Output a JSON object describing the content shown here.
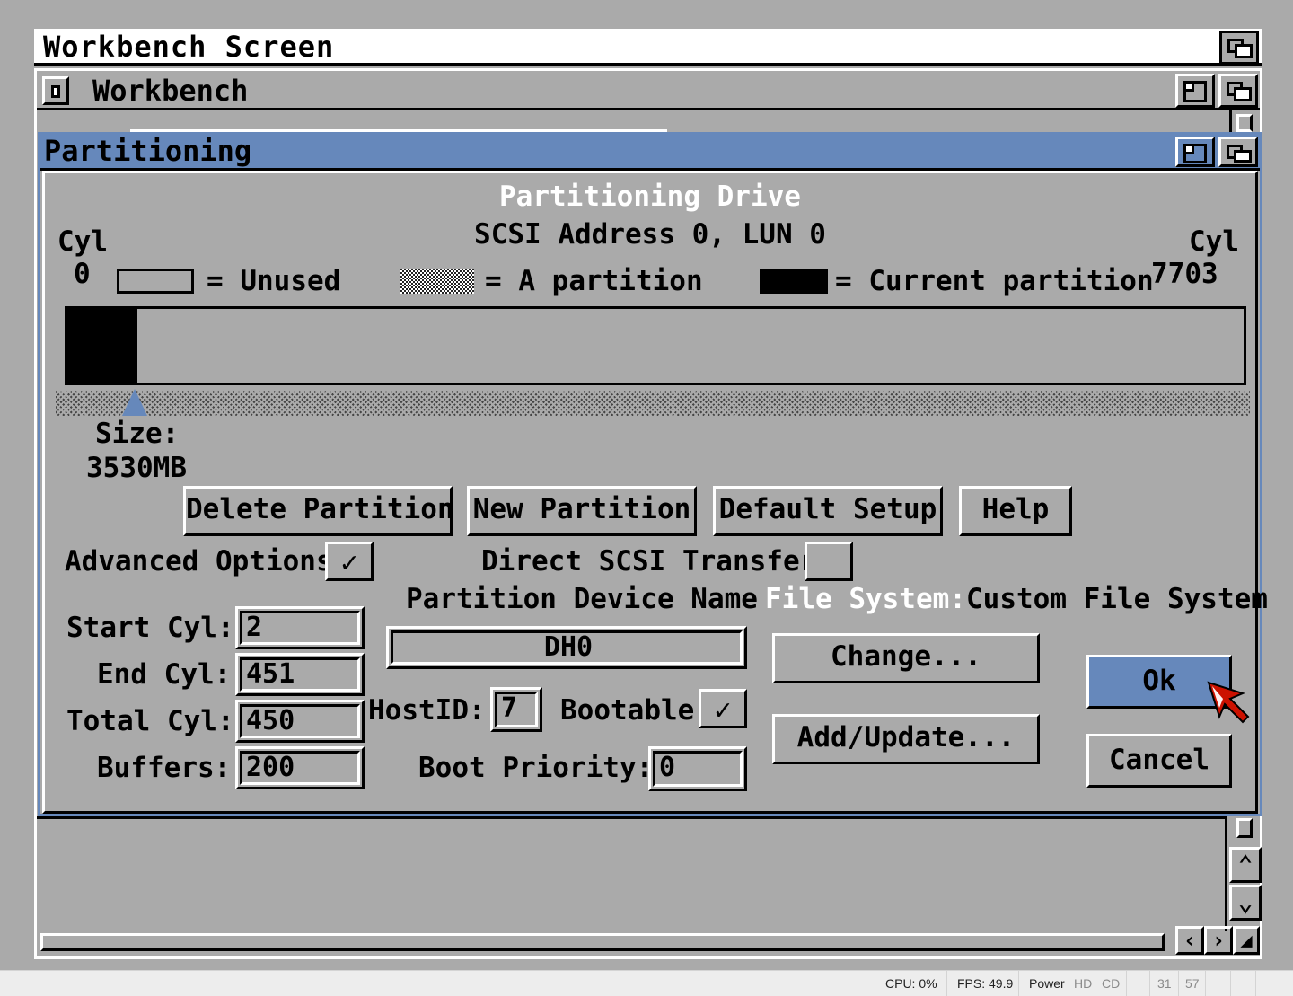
{
  "screen": {
    "title": "Workbench Screen"
  },
  "workbench_window": {
    "title": "Workbench"
  },
  "dialog": {
    "title": "Partitioning",
    "header": {
      "title": "Partitioning Drive",
      "address": "SCSI Address 0, LUN 0"
    },
    "cyl_left": {
      "label": "Cyl",
      "value": "0"
    },
    "cyl_right": {
      "label": "Cyl",
      "value": "7703"
    },
    "legend": {
      "unused": "= Unused",
      "partition": "= A partition",
      "current": "= Current partition"
    },
    "size": {
      "label": "Size:",
      "value": "3530MB"
    },
    "buttons": {
      "delete": "Delete Partition",
      "new": "New Partition",
      "default": "Default Setup",
      "help": "Help",
      "change": "Change...",
      "add_update": "Add/Update...",
      "ok": "Ok",
      "cancel": "Cancel"
    },
    "advanced_options": {
      "label": "Advanced Options",
      "checked": true,
      "mark": "✓"
    },
    "direct_scsi": {
      "label": "Direct SCSI Transfer",
      "checked": false,
      "mark": ""
    },
    "fields": {
      "start_cyl": {
        "label": "Start Cyl:",
        "value": "2"
      },
      "end_cyl": {
        "label": "End Cyl:",
        "value": "451"
      },
      "total_cyl": {
        "label": "Total Cyl:",
        "value": "450"
      },
      "buffers": {
        "label": "Buffers:",
        "value": "200"
      }
    },
    "device_name": {
      "label": "Partition Device Name",
      "value": "DH0"
    },
    "file_system": {
      "label": "File System:",
      "value": "Custom File System"
    },
    "host_id": {
      "label": "HostID:",
      "value": "7"
    },
    "bootable": {
      "label": "Bootable",
      "checked": true,
      "mark": "✓"
    },
    "boot_priority": {
      "label": "Boot Priority:",
      "value": "0"
    }
  },
  "status_bar": {
    "cpu": "CPU: 0%",
    "fps": "FPS: 49.9",
    "power": "Power",
    "hd": "HD",
    "cd": "CD",
    "n1": "31",
    "n2": "57"
  },
  "colors": {
    "amiga_blue": "#6688bb",
    "amiga_gray": "#aaaaaa"
  }
}
